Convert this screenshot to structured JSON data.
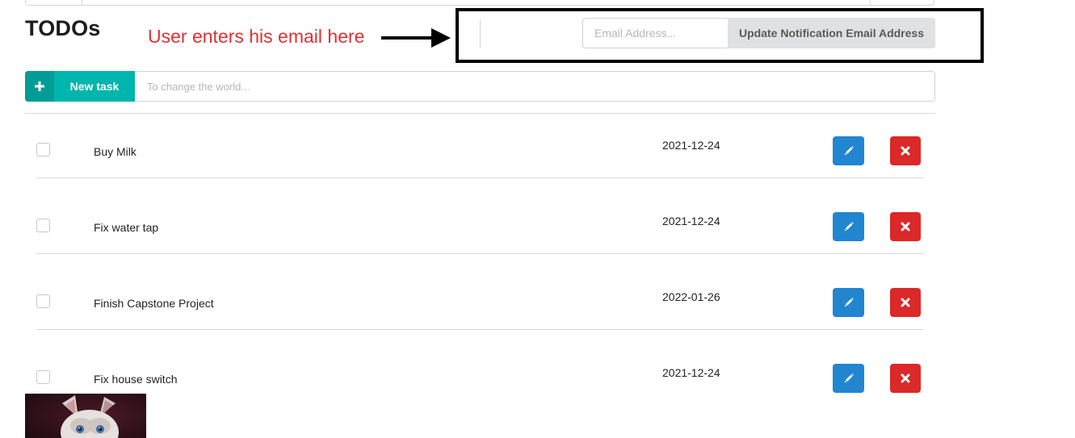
{
  "header": {
    "title": "TODOs"
  },
  "annotation": {
    "text": "User enters his email here",
    "color": "#e03131"
  },
  "email_form": {
    "placeholder": "Email Address...",
    "value": "",
    "update_button_label": "Update Notification Email Address"
  },
  "new_task": {
    "button_label": "New task",
    "button_icon": "plus-icon",
    "placeholder": "To change the world...",
    "value": ""
  },
  "tasks": [
    {
      "name": "Buy Milk",
      "due_date": "2021-12-24",
      "done": false
    },
    {
      "name": "Fix water tap",
      "due_date": "2021-12-24",
      "done": false
    },
    {
      "name": "Finish Capstone Project",
      "due_date": "2022-01-26",
      "done": false
    },
    {
      "name": "Fix house switch",
      "due_date": "2021-12-24",
      "done": false
    }
  ],
  "row_actions": {
    "edit_icon": "pencil-icon",
    "delete_icon": "close-icon"
  },
  "attachment": {
    "image_subject": "kitten"
  },
  "colors": {
    "accent_teal": "#00b5ad",
    "edit_blue": "#2185d0",
    "delete_red": "#db2828",
    "annotation_red": "#e03131"
  }
}
